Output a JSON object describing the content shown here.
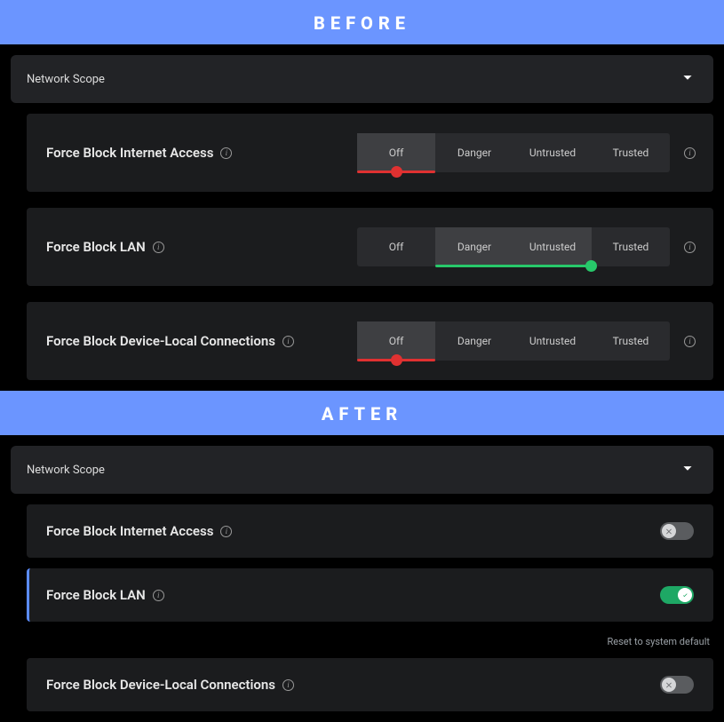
{
  "banners": {
    "before": "BEFORE",
    "after": "AFTER"
  },
  "header": {
    "title": "Network Scope"
  },
  "sliderOptions": [
    "Off",
    "Danger",
    "Untrusted",
    "Trusted"
  ],
  "before": {
    "rows": [
      {
        "label": "Force Block Internet Access",
        "selected": 0,
        "selSpan": 1,
        "color": "#e03131"
      },
      {
        "label": "Force Block LAN",
        "selected": 2,
        "selStart": 1,
        "selSpan": 2,
        "color": "#27c86a"
      },
      {
        "label": "Force Block Device-Local Connections",
        "selected": 0,
        "selSpan": 1,
        "color": "#e03131"
      }
    ]
  },
  "after": {
    "rows": [
      {
        "label": "Force Block Internet Access",
        "on": false,
        "active": false
      },
      {
        "label": "Force Block LAN",
        "on": true,
        "active": true
      },
      {
        "label": "Force Block Device-Local Connections",
        "on": false,
        "active": false
      }
    ],
    "resetLabel": "Reset to system default"
  }
}
